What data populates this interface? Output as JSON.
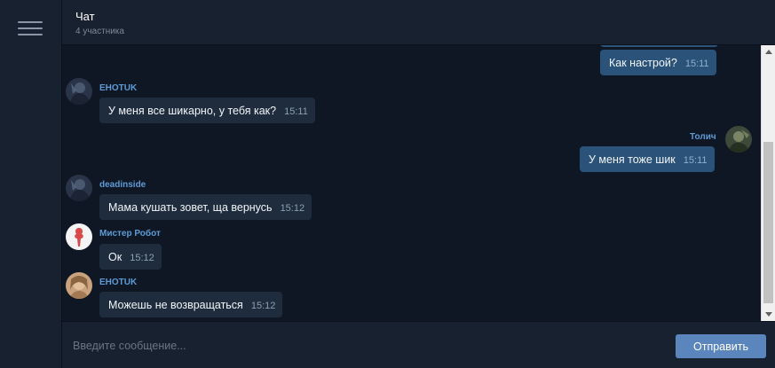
{
  "header": {
    "title": "Чат",
    "subtitle": "4 участника"
  },
  "messages": [
    {
      "sender": "",
      "text": "Как настрой?",
      "time": "15:11",
      "own": true
    },
    {
      "sender": "EHOTUK",
      "text": "У меня все шикарно, у тебя как?",
      "time": "15:11",
      "own": false
    },
    {
      "sender": "Толич",
      "text": "У меня тоже шик",
      "time": "15:11",
      "own": true
    },
    {
      "sender": "deadinside",
      "text": "Мама кушать зовет, ща вернусь",
      "time": "15:12",
      "own": false
    },
    {
      "sender": "Мистер Робот",
      "text": "Ок",
      "time": "15:12",
      "own": false
    },
    {
      "sender": "EHOTUK",
      "text": "Можешь не возвращаться",
      "time": "15:12",
      "own": false
    }
  ],
  "composer": {
    "placeholder": "Введите сообщение...",
    "send_label": "Отправить"
  },
  "colors": {
    "background": "#0f1724",
    "panel": "#17212f",
    "incoming_bubble": "#1e2c3d",
    "outgoing_bubble": "#2b5278",
    "sender_name": "#5e9bd6",
    "send_button": "#5b86bd"
  },
  "icons": {
    "menu": "hamburger-menu-icon"
  }
}
